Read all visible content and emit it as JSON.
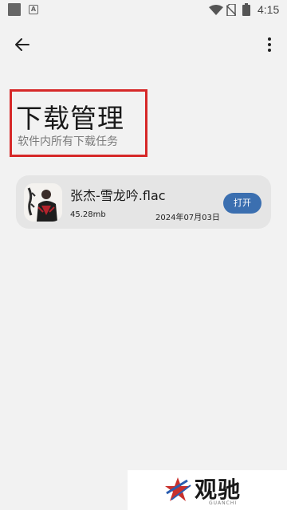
{
  "status_bar": {
    "time": "4:15",
    "icons": [
      "app-icon",
      "a-notification-icon",
      "wifi-icon",
      "no-sim-icon",
      "battery-icon"
    ]
  },
  "toolbar": {
    "back_icon": "arrow-back-icon",
    "more_icon": "more-vert-icon"
  },
  "header": {
    "title": "下载管理",
    "subtitle": "软件内所有下载任务"
  },
  "downloads": [
    {
      "file_name": "张杰-雪龙吟.flac",
      "size": "45.28mb",
      "date": "2024年07月03日",
      "action_label": "打开"
    }
  ],
  "watermark": {
    "brand": "观驰",
    "sub": "GUANCHI"
  },
  "colors": {
    "background": "#f2f2f2",
    "card": "#e5e5e5",
    "accent": "#3b6fb0",
    "highlight_box": "#d62828"
  }
}
